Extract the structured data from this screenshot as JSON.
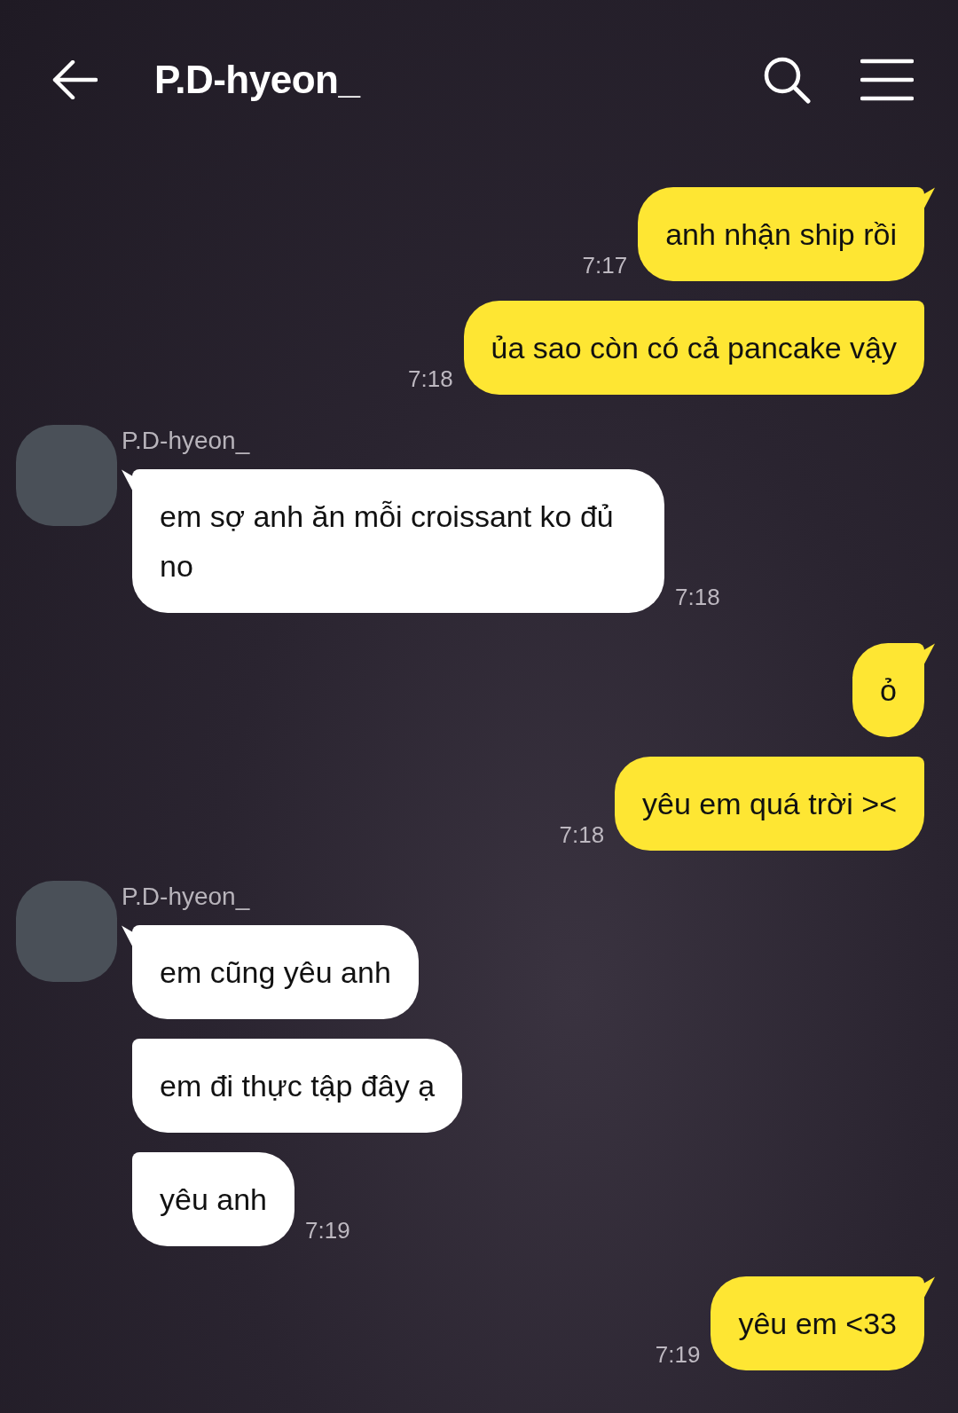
{
  "header": {
    "title": "P.D-hyeon_"
  },
  "groups": [
    {
      "kind": "sent",
      "bubbles": [
        {
          "text": "anh nhận ship rồi",
          "time": "7:17"
        },
        {
          "text": "ủa sao còn có cả pancake vậy",
          "time": "7:18"
        }
      ]
    },
    {
      "kind": "received",
      "sender": "P.D-hyeon_",
      "bubbles": [
        {
          "text": "em sợ anh ăn mỗi croissant ko đủ no",
          "time": "7:18"
        }
      ]
    },
    {
      "kind": "sent",
      "bubbles": [
        {
          "text": "ỏ"
        },
        {
          "text": "yêu em quá trời ><",
          "time": "7:18"
        }
      ]
    },
    {
      "kind": "received",
      "sender": "P.D-hyeon_",
      "bubbles": [
        {
          "text": "em cũng yêu anh"
        },
        {
          "text": "em đi thực tập đây ạ"
        },
        {
          "text": "yêu anh",
          "time": "7:19"
        }
      ]
    },
    {
      "kind": "sent",
      "bubbles": [
        {
          "text": "yêu em <33",
          "time": "7:19"
        }
      ]
    }
  ]
}
